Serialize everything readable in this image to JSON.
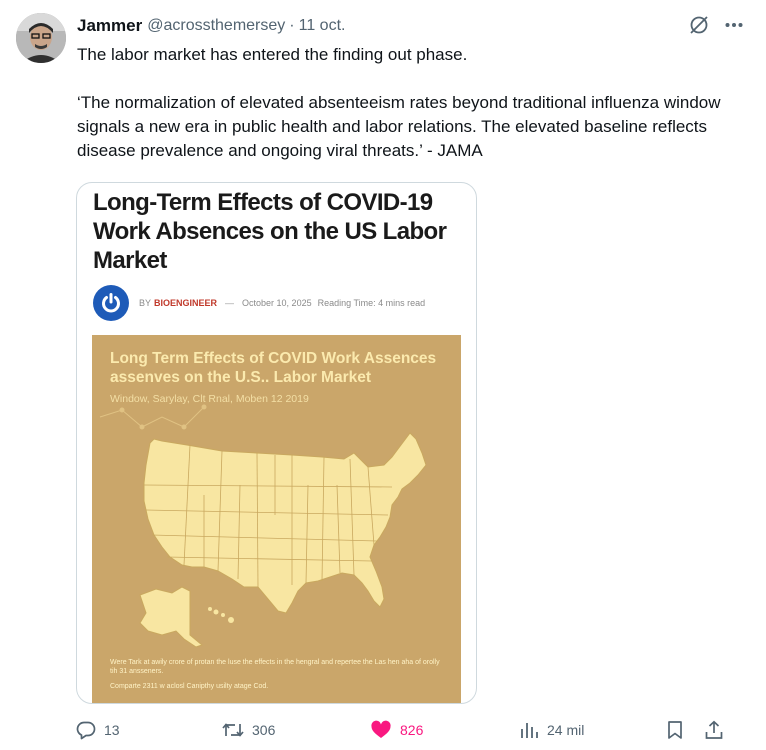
{
  "tweet": {
    "author_name": "Jammer",
    "handle": "@acrossthemersey",
    "separator": "·",
    "date": "11 oct.",
    "text_line1": "The labor market has entered the finding out phase.",
    "text_quote": "‘The normalization of elevated absenteeism rates beyond traditional influenza window signals a new era in public health and labor relations.  The elevated baseline reflects disease prevalence and ongoing viral threats.’ - JAMA"
  },
  "card": {
    "title": "Long-Term Effects of COVID-19 Work Absences on the US Labor Market",
    "by_prefix": "BY",
    "by_name": "BIOENGINEER",
    "by_sep": "—",
    "by_date": "October 10, 2025",
    "reading_time": "Reading Time: 4 mins read",
    "infographic": {
      "title": "Long Term Effects of COVID Work Assences assenves on the U.S.. Labor Market",
      "subtitle": "Window, Sarylay, Clt Rnal, Moben 12 2019",
      "footer1": "Were Tark at awily crore of protan the luse the effects in the hengral and repertee the Las hen aha of orolly tih 31 ansseners.",
      "footer2": "Comparte 2311 w aclosl Canipthy usilty atage Cod."
    }
  },
  "actions": {
    "replies": "13",
    "reposts": "306",
    "likes": "826",
    "views": "24 mil"
  },
  "colors": {
    "like_active": "#f91880",
    "muted_text": "#536471",
    "infographic_bg": "#caa66a",
    "map_fill": "#f8e6a2"
  }
}
